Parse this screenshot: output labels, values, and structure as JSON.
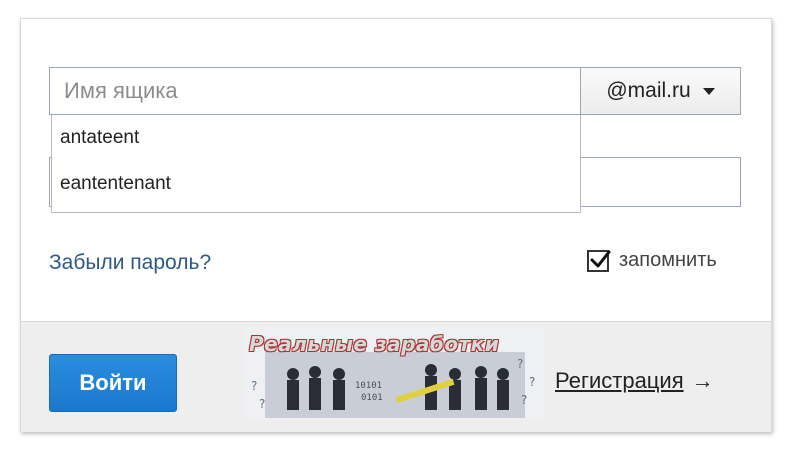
{
  "login": {
    "placeholder": "Имя ящика",
    "value": "",
    "domain": "@mail.ru"
  },
  "autocomplete": {
    "items": [
      "antateent",
      "eantentenant"
    ]
  },
  "forgot_password": "Забыли пароль?",
  "remember": {
    "label": "запомнить",
    "checked": true
  },
  "footer": {
    "login_button": "Войти",
    "ad_banner_text": "Реальные заработки",
    "register_label": "Регистрация",
    "register_arrow": "→"
  },
  "colors": {
    "button_blue": "#1f82d6",
    "link_blue": "#2b5a86",
    "footer_bg": "#eeeeee"
  }
}
